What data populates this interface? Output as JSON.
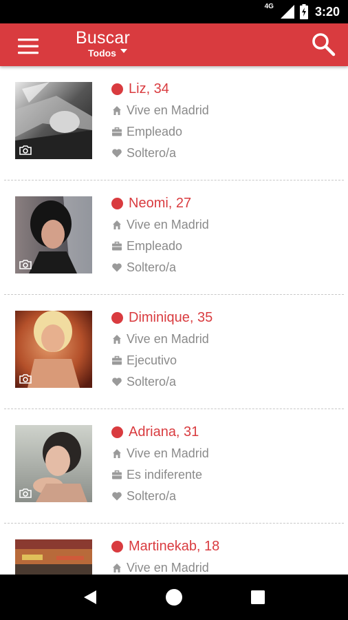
{
  "status_bar": {
    "network": "4G",
    "time": "3:20"
  },
  "app_bar": {
    "title": "Buscar",
    "filter": "Todos"
  },
  "colors": {
    "accent": "#d93b3f",
    "text_secondary": "#8a8a8a",
    "divider": "#c7c7c7"
  },
  "icons": {
    "menu": "menu-icon",
    "search": "search-icon",
    "dropdown": "caret-down-icon",
    "online": "online-dot",
    "home": "home-icon",
    "job": "briefcase-icon",
    "status": "heart-icon",
    "photo": "camera-icon"
  },
  "profiles": [
    {
      "name": "Liz, 34",
      "location": "Vive en Madrid",
      "job": "Empleado",
      "status": "Soltero/a"
    },
    {
      "name": "Neomi, 27",
      "location": "Vive en Madrid",
      "job": "Empleado",
      "status": "Soltero/a"
    },
    {
      "name": "Diminique, 35",
      "location": "Vive en Madrid",
      "job": "Ejecutivo",
      "status": "Soltero/a"
    },
    {
      "name": "Adriana, 31",
      "location": "Vive en Madrid",
      "job": "Es indiferente",
      "status": "Soltero/a"
    },
    {
      "name": "Martinekab, 18",
      "location": "Vive en Madrid",
      "job": "",
      "status": ""
    }
  ]
}
